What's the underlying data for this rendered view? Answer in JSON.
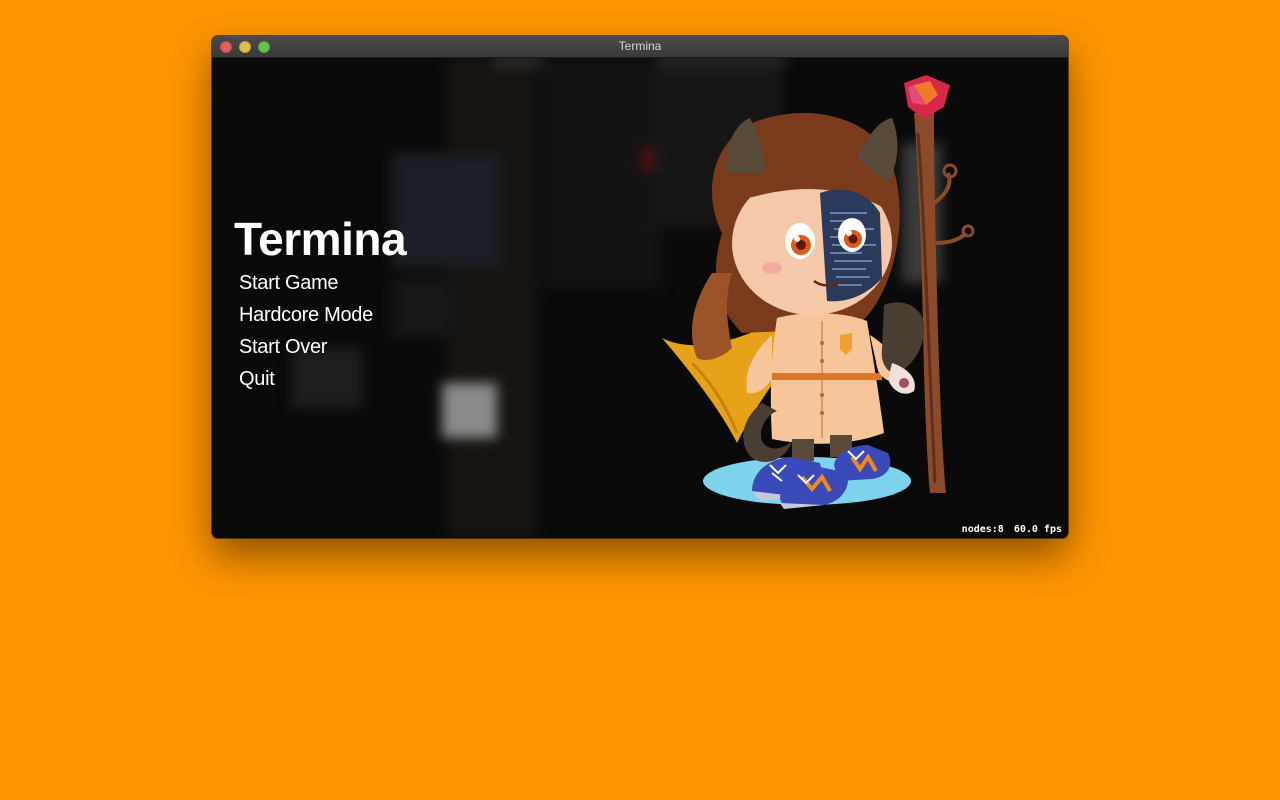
{
  "window": {
    "title": "Termina"
  },
  "menu": {
    "title": "Termina",
    "items": [
      "Start Game",
      "Hardcore Mode",
      "Start Over",
      "Quit"
    ]
  },
  "stats": {
    "nodes": "nodes:8",
    "fps": "60.0 fps"
  },
  "colors": {
    "desktop": "#ff9500",
    "scene": "#0a0a0a",
    "text": "#ffffff"
  }
}
